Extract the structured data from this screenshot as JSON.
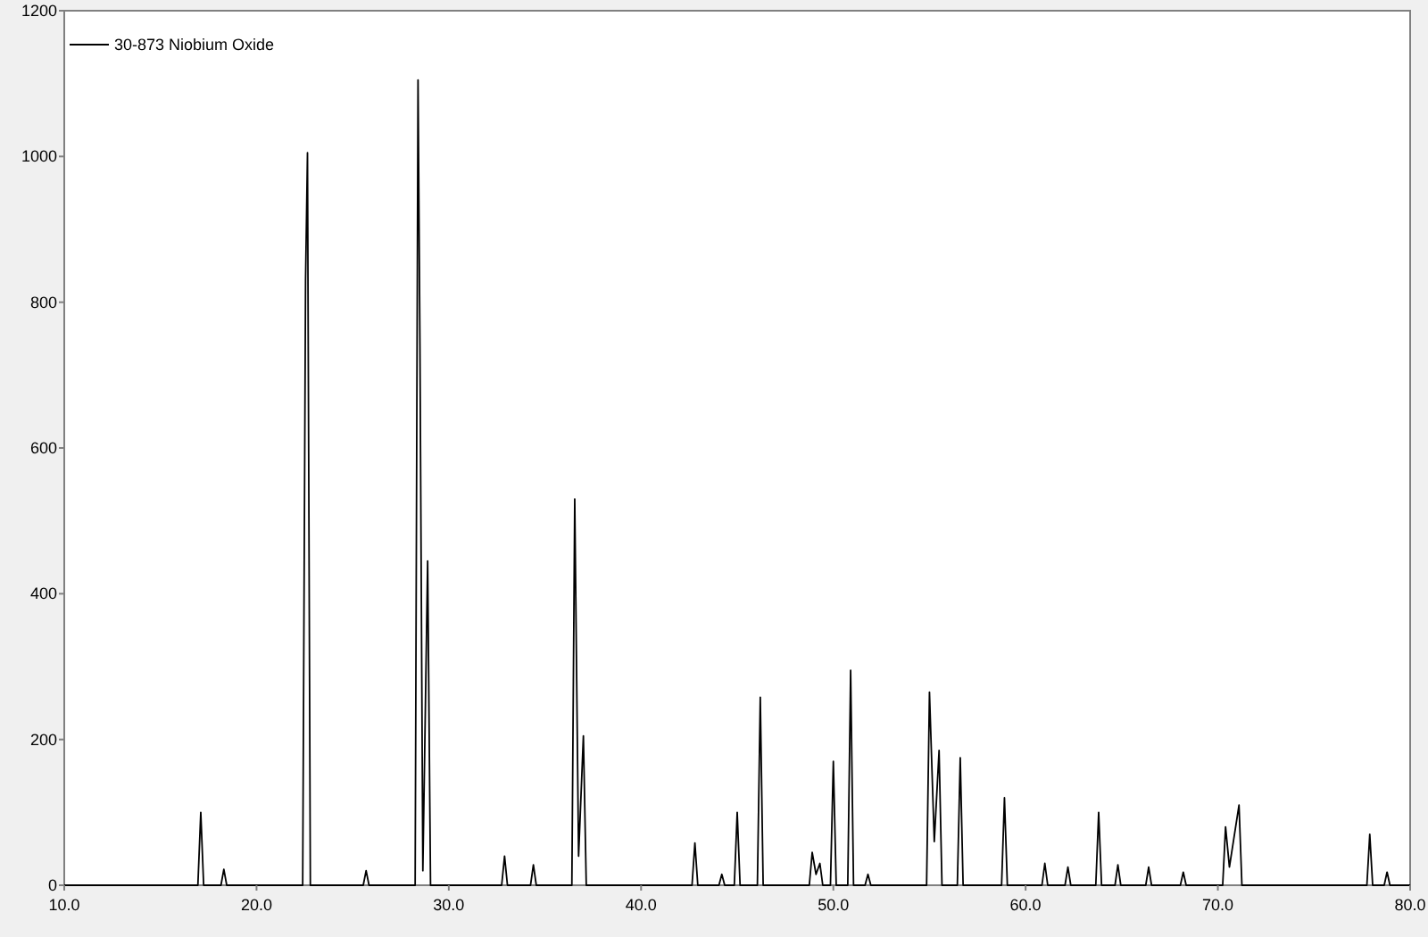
{
  "chart_data": {
    "type": "line",
    "xlim": [
      10,
      80
    ],
    "ylim": [
      0,
      1200
    ],
    "xticks": [
      {
        "value": 10,
        "label": "10.0"
      },
      {
        "value": 20,
        "label": "20.0"
      },
      {
        "value": 30,
        "label": "30.0"
      },
      {
        "value": 40,
        "label": "40.0"
      },
      {
        "value": 50,
        "label": "50.0"
      },
      {
        "value": 60,
        "label": "60.0"
      },
      {
        "value": 70,
        "label": "70.0"
      },
      {
        "value": 80,
        "label": "80.0"
      }
    ],
    "yticks": [
      0,
      200,
      400,
      600,
      800,
      1000,
      1200
    ],
    "x": [
      10.0,
      16.95,
      17.1,
      17.25,
      18.15,
      18.3,
      18.45,
      22.4,
      22.55,
      22.65,
      22.8,
      25.55,
      25.7,
      25.85,
      28.25,
      28.4,
      28.5,
      28.65,
      28.9,
      29.05,
      32.75,
      32.9,
      33.05,
      34.25,
      34.4,
      34.55,
      36.4,
      36.55,
      36.75,
      37.0,
      37.15,
      42.65,
      42.8,
      42.95,
      44.05,
      44.2,
      44.35,
      44.85,
      45.0,
      45.15,
      46.05,
      46.2,
      46.35,
      48.75,
      48.9,
      49.1,
      49.3,
      49.45,
      49.85,
      50.0,
      50.15,
      50.75,
      50.9,
      51.05,
      51.65,
      51.8,
      51.95,
      54.85,
      55.0,
      55.25,
      55.5,
      55.65,
      56.45,
      56.6,
      56.75,
      58.75,
      58.9,
      59.05,
      60.85,
      61.0,
      61.15,
      62.05,
      62.2,
      62.35,
      63.65,
      63.8,
      63.95,
      64.65,
      64.8,
      64.95,
      66.25,
      66.4,
      66.55,
      68.05,
      68.2,
      68.35,
      70.25,
      70.4,
      70.6,
      71.1,
      71.25,
      77.75,
      77.9,
      78.05,
      78.65,
      78.8,
      78.95,
      80.0
    ],
    "series": [
      {
        "name": "30-873 Niobium Oxide",
        "color": "#000000",
        "values": [
          0,
          0,
          100,
          0,
          0,
          22,
          0,
          0,
          830,
          1005,
          0,
          0,
          20,
          0,
          0,
          1105,
          740,
          20,
          445,
          0,
          0,
          40,
          0,
          0,
          28,
          0,
          0,
          530,
          40,
          205,
          0,
          0,
          58,
          0,
          0,
          15,
          0,
          0,
          100,
          0,
          0,
          258,
          0,
          0,
          45,
          15,
          30,
          0,
          0,
          170,
          0,
          0,
          295,
          0,
          0,
          15,
          0,
          0,
          265,
          60,
          185,
          0,
          0,
          175,
          0,
          0,
          120,
          0,
          0,
          30,
          0,
          0,
          25,
          0,
          0,
          100,
          0,
          0,
          28,
          0,
          0,
          25,
          0,
          0,
          18,
          0,
          0,
          80,
          25,
          110,
          0,
          0,
          70,
          0,
          0,
          18,
          0,
          0
        ]
      }
    ]
  }
}
